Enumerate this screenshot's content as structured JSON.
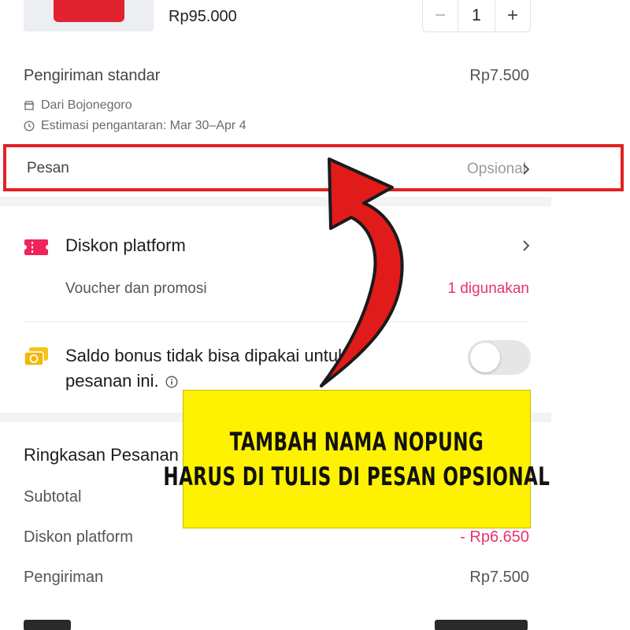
{
  "product": {
    "price": "Rp95.000",
    "quantity": "1",
    "minus_symbol": "−",
    "plus_symbol": "+"
  },
  "shipping": {
    "title": "Pengiriman standar",
    "price": "Rp7.500",
    "origin": "Dari Bojonegoro",
    "estimate": "Estimasi pengantaran: Mar 30–Apr 4"
  },
  "message": {
    "label": "Pesan",
    "placeholder": "Opsional"
  },
  "discount": {
    "title": "Diskon platform",
    "voucher_label": "Voucher dan promosi",
    "voucher_status": "1 digunakan"
  },
  "bonus": {
    "text": "Saldo bonus tidak bisa dipakai untuk pesanan ini.",
    "toggle_on": false
  },
  "summary": {
    "title": "Ringkasan Pesanan",
    "rows": [
      {
        "label": "Subtotal",
        "value": ""
      },
      {
        "label": "Diskon platform",
        "value": "- Rp6.650"
      },
      {
        "label": "Pengiriman",
        "value": "Rp7.500"
      }
    ]
  },
  "annotation": {
    "line1": "TAMBAH NAMA NOPUNG",
    "line2": "HARUS DI TULIS DI PESAN OPSIONAL"
  },
  "colors": {
    "accent_pink": "#e8336e",
    "highlight_red": "#e12124",
    "callout_yellow": "#fff200",
    "product_red": "#e0232e"
  },
  "icons": {
    "store": "store-icon",
    "clock": "clock-icon",
    "chevron": "chevron-right-icon",
    "ticket": "ticket-icon",
    "coins": "coins-icon",
    "info": "info-icon"
  }
}
